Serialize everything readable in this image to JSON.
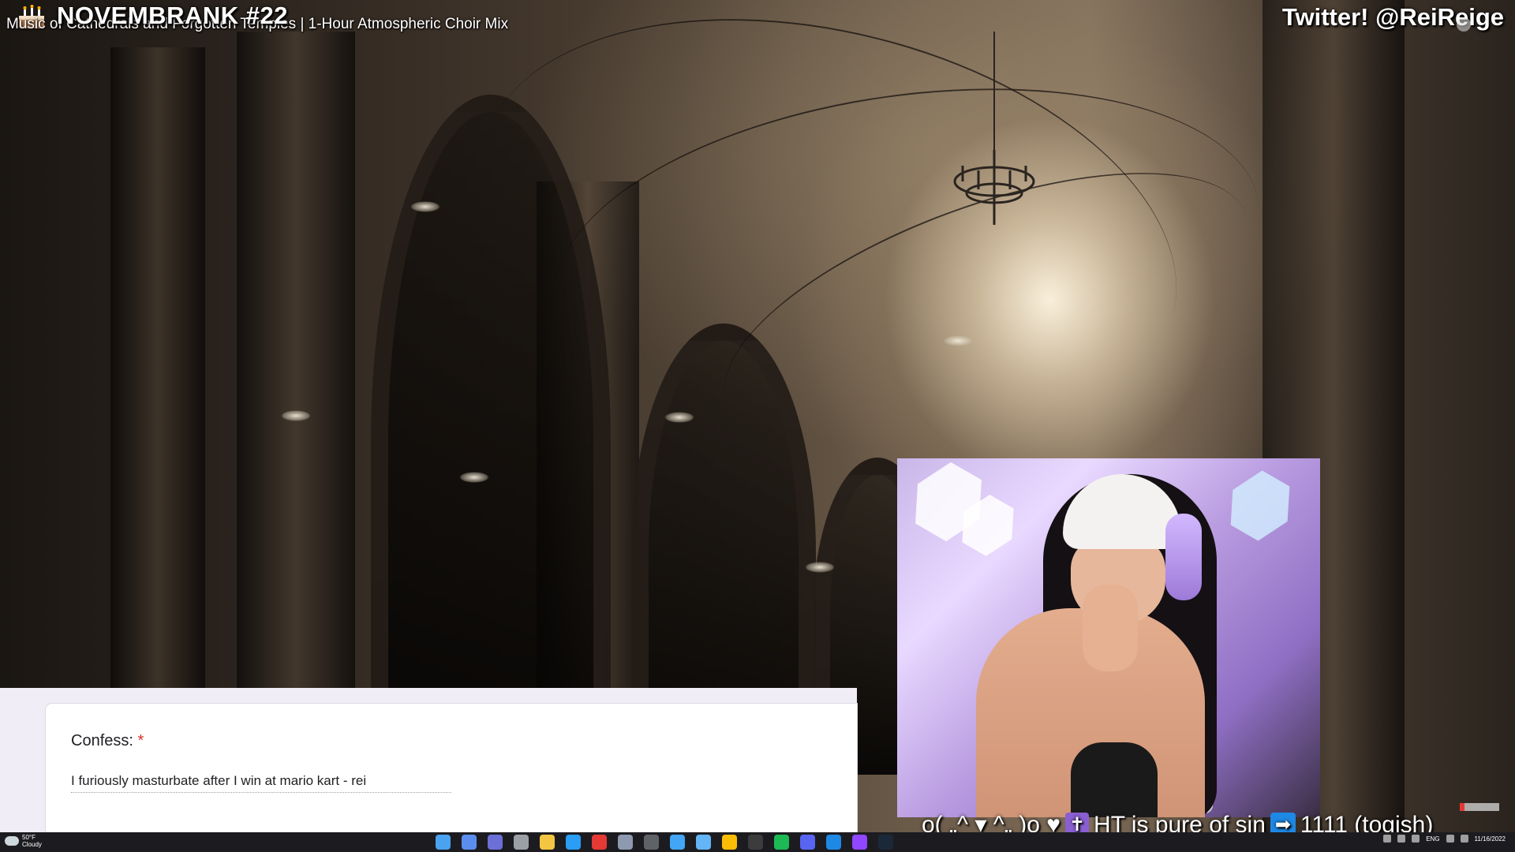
{
  "overlay": {
    "stream_title": "NOVEMBRANK #22",
    "video_title": "Music of Cathedrals and Forgotten Temples | 1-Hour Atmospheric Choir Mix",
    "twitter": "Twitter! @ReiReige",
    "cake_icon": "cake-icon"
  },
  "form": {
    "question": "Confess:",
    "required_mark": "*",
    "answer": "I furiously masturbate after I win at mario kart - rei"
  },
  "webcam": {
    "ticker_prefix": "o( „^ ▾ ^„ )o ♥",
    "cross_icon": "✝",
    "ticker_middle": "HT is pure of sin",
    "arrow_icon": "➡",
    "ticker_suffix": "1111 (togish)"
  },
  "taskbar": {
    "weather_temp": "50°F",
    "weather_desc": "Cloudy",
    "lang": "ENG",
    "time": "",
    "date": "11/16/2022",
    "apps": [
      {
        "name": "windows-start-icon",
        "color": "#4aa3f0"
      },
      {
        "name": "search-icon",
        "color": "#5b8def"
      },
      {
        "name": "teams-icon",
        "color": "#6b6fd6"
      },
      {
        "name": "settings-icon",
        "color": "#9aa0a6"
      },
      {
        "name": "file-explorer-icon",
        "color": "#f4c542"
      },
      {
        "name": "mail-icon",
        "color": "#2a9df4"
      },
      {
        "name": "app-red-icon",
        "color": "#e53935"
      },
      {
        "name": "camera-icon",
        "color": "#8d99ae"
      },
      {
        "name": "calculator-icon",
        "color": "#5f6368"
      },
      {
        "name": "paint-icon",
        "color": "#42a5f5"
      },
      {
        "name": "notepad-icon",
        "color": "#64b5f6"
      },
      {
        "name": "chrome-icon",
        "color": "#fbbc05"
      },
      {
        "name": "obs-icon",
        "color": "#3c3c3c"
      },
      {
        "name": "spotify-icon",
        "color": "#1db954"
      },
      {
        "name": "discord-icon",
        "color": "#5865f2"
      },
      {
        "name": "app-blue-icon",
        "color": "#1e88e5"
      },
      {
        "name": "twitch-icon",
        "color": "#9146ff"
      },
      {
        "name": "steam-icon",
        "color": "#1b2838"
      }
    ]
  }
}
